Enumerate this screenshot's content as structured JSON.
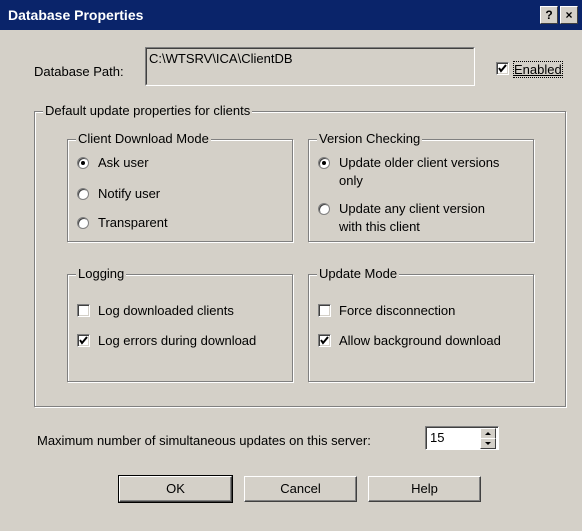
{
  "window": {
    "title": "Database Properties",
    "help_button": "?",
    "close_button": "×"
  },
  "database_path": {
    "label": "Database Path:",
    "value": "C:\\WTSRV\\ICA\\ClientDB"
  },
  "enabled": {
    "label": "Enabled",
    "checked": true
  },
  "defaults_group": {
    "title": "Default update properties for clients"
  },
  "download_mode": {
    "title": "Client Download Mode",
    "options": [
      {
        "label": "Ask user",
        "selected": true
      },
      {
        "label": "Notify user",
        "selected": false
      },
      {
        "label": "Transparent",
        "selected": false
      }
    ]
  },
  "version_checking": {
    "title": "Version Checking",
    "options": [
      {
        "line1": "Update older client versions",
        "line2": "only",
        "selected": true
      },
      {
        "line1": "Update any client version",
        "line2": "with this client",
        "selected": false
      }
    ]
  },
  "logging": {
    "title": "Logging",
    "options": [
      {
        "label": "Log downloaded clients",
        "checked": false
      },
      {
        "label": "Log errors during download",
        "checked": true
      }
    ]
  },
  "update_mode": {
    "title": "Update Mode",
    "options": [
      {
        "label": "Force disconnection",
        "checked": false
      },
      {
        "label": "Allow background download",
        "checked": true
      }
    ]
  },
  "max_updates": {
    "label": "Maximum number of simultaneous updates on this server:",
    "value": "15"
  },
  "buttons": {
    "ok": "OK",
    "cancel": "Cancel",
    "help": "Help"
  }
}
